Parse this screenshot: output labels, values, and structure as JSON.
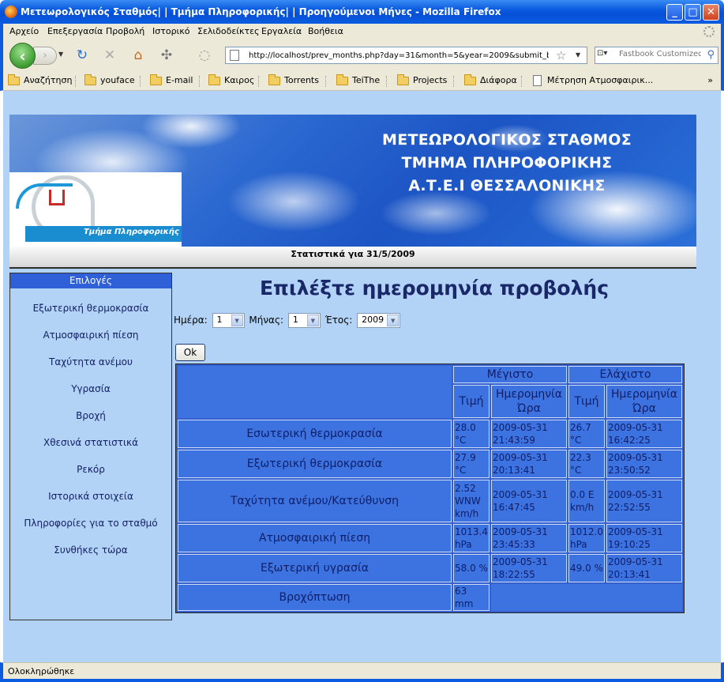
{
  "window": {
    "title": "Μετεωρολογικός Σταθμός| | Τμήμα Πληροφορικής| | Προηγούμενοι Μήνες - Mozilla Firefox",
    "minimize": "_",
    "maximize": "□",
    "close": "✕"
  },
  "menu": [
    "Αρχείο",
    "Επεξεργασία",
    "Προβολή",
    "Ιστορικό",
    "Σελιδοδείκτες",
    "Εργαλεία",
    "Βοήθεια"
  ],
  "nav": {
    "back": "‹",
    "forward": "›",
    "url": "http://localhost/prev_months.php?day=31&month=5&year=2009&submit_butt",
    "search_placeholder": "Fastbook Customized"
  },
  "bookmarks": [
    "Αναζήτηση",
    "youface",
    "E-mail",
    "Καιρος",
    "Torrents",
    "TeiThe",
    "Projects",
    "Διάφορα",
    "Μέτρηση Ατμοσφαιρικ..."
  ],
  "bookmarks_more": "»",
  "banner": {
    "line1": "ΜΕΤΕΩΡΟΛΟΓΙΚΟΣ ΣΤΑΘΜΟΣ",
    "line2": "ΤΜΗΜΑ ΠΛΗΡΟΦΟΡΙΚΗΣ",
    "line3": "Α.Τ.Ε.Ι ΘΕΣΣΑΛΟΝΙΚΗΣ",
    "logo_text": "Τμήμα Πληροφορικής"
  },
  "stats_header": "Στατιστικά για 31/5/2009",
  "sidebar": {
    "title": "Επιλογές",
    "items": [
      "Εξωτερική θερμοκρασία",
      "Ατμοσφαιρική πίεση",
      "Ταχύτητα ανέμου",
      "Υγρασία",
      "Βροχή",
      "Χθεσινά στατιστικά",
      "Ρεκόρ",
      "Ιστορικά στοιχεία",
      "Πληροφορίες για το σταθμό",
      "Συνθήκες τώρα"
    ]
  },
  "main": {
    "heading": "Επιλέξτε ημερομηνία προβολής",
    "day_label": "Ημέρα:",
    "day_value": "1",
    "month_label": "Μήνας:",
    "month_value": "1",
    "year_label": "Έτος:",
    "year_value": "2009",
    "ok": "Ok"
  },
  "table": {
    "max_label": "Μέγιστο",
    "min_label": "Ελάχιστο",
    "value_col": "Τιμή",
    "datetime_col": "Ημερομηνία Ώρα",
    "rows": [
      {
        "label": "Εσωτερική θερμοκρασία",
        "max_val": "28.0 °C",
        "max_dt": "2009-05-31 21:43:59",
        "min_val": "26.7 °C",
        "min_dt": "2009-05-31 16:42:25"
      },
      {
        "label": "Εξωτερική θερμοκρασία",
        "max_val": "27.9 °C",
        "max_dt": "2009-05-31 20:13:41",
        "min_val": "22.3 °C",
        "min_dt": "2009-05-31 23:50:52"
      },
      {
        "label": "Ταχύτητα ανέμου/Κατεύθυνση",
        "max_val": "2.52 WNW km/h",
        "max_dt": "2009-05-31 16:47:45",
        "min_val": "0.0 E km/h",
        "min_dt": "2009-05-31 22:52:55"
      },
      {
        "label": "Ατμοσφαιρική πίεση",
        "max_val": "1013.4 hPa",
        "max_dt": "2009-05-31 23:45:33",
        "min_val": "1012.0 hPa",
        "min_dt": "2009-05-31 19:10:25"
      },
      {
        "label": "Εξωτερική υγρασία",
        "max_val": "58.0 %",
        "max_dt": "2009-05-31 18:22:55",
        "min_val": "49.0 %",
        "min_dt": "2009-05-31 20:13:41"
      }
    ],
    "rain_label": "Βροχόπτωση",
    "rain_value": "63 mm"
  },
  "status": "Ολοκληρώθηκε"
}
